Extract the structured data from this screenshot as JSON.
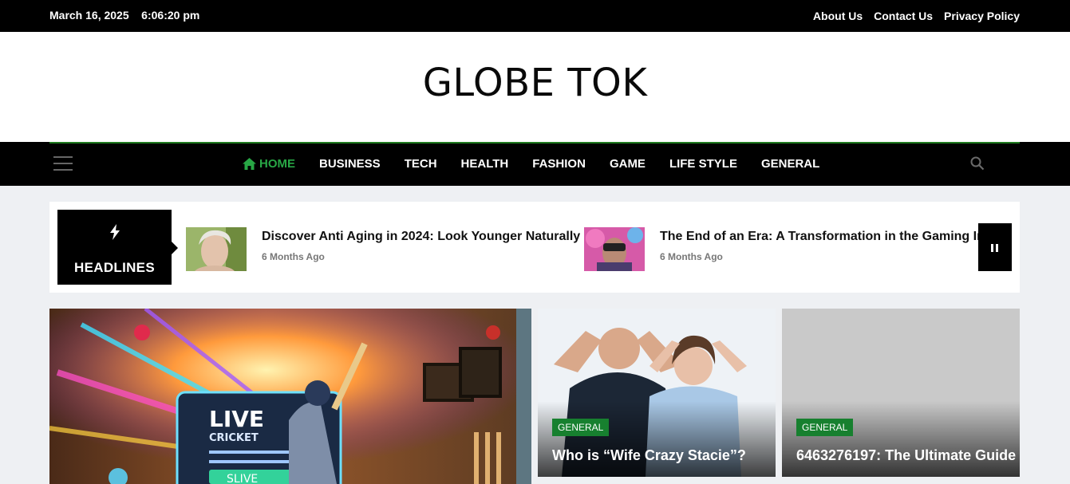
{
  "topbar": {
    "datetime": "March 16, 2025    6:06:20 pm",
    "links": [
      "About Us",
      "Contact Us",
      "Privacy Policy"
    ]
  },
  "brand": {
    "logo": "GLOBE TOK"
  },
  "nav": {
    "items": [
      "HOME",
      "BUSINESS",
      "TECH",
      "HEALTH",
      "FASHION",
      "GAME",
      "LIFE STYLE",
      "GENERAL"
    ],
    "active": "HOME",
    "icons": {
      "home": "home-icon",
      "menu": "hamburger-icon",
      "search": "search-icon"
    }
  },
  "headlines": {
    "label": "HEADLINES",
    "items": [
      {
        "title": "Discover Anti Aging in 2024: Look Younger Naturally",
        "ago": "6 Months Ago"
      },
      {
        "title": "The End of an Era: A Transformation in the Gaming Industry",
        "ago": "6 Months Ago"
      }
    ]
  },
  "featured": {
    "main": {
      "image_text_1": "LIVE",
      "image_text_2": "CRICKET",
      "image_text_3": "SLIVE"
    },
    "cards": [
      {
        "category": "GENERAL",
        "title": "Who is “Wife Crazy Stacie”?"
      },
      {
        "category": "GENERAL",
        "title": "6463276197: The Ultimate Guide"
      }
    ]
  },
  "colors": {
    "accent": "#28a745",
    "category_bg": "#17802f",
    "topbar": "#000000",
    "page_bg": "#eef0f3"
  }
}
